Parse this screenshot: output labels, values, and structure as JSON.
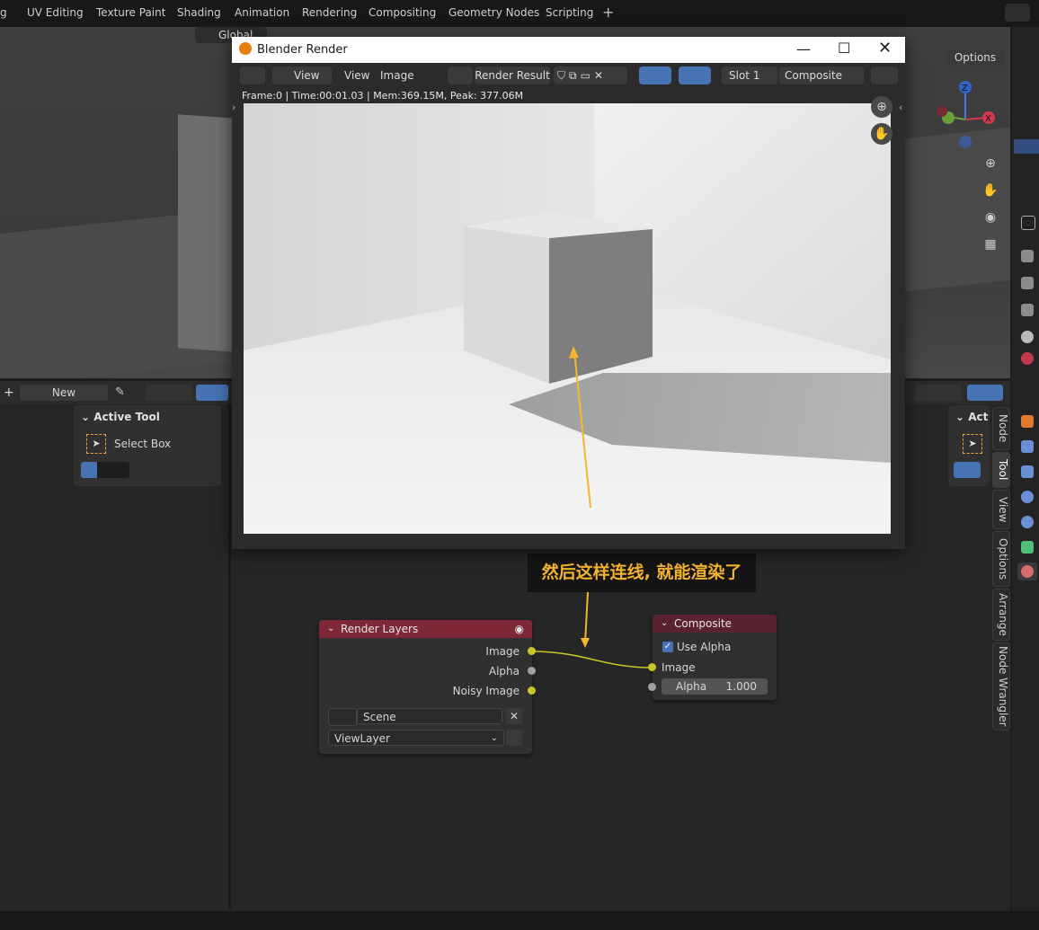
{
  "workspace_tabs": [
    "g",
    "UV Editing",
    "Texture Paint",
    "Shading",
    "Animation",
    "Rendering",
    "Compositing",
    "Geometry Nodes",
    "Scripting",
    "+"
  ],
  "viewport": {
    "transform_orientation": "Global",
    "options_label": "Options"
  },
  "node_editor": {
    "new_button": "New",
    "plus": "+",
    "active_tool_panel": {
      "title": "Active Tool",
      "tool_name": "Select Box"
    },
    "right_tool_title": "Act",
    "side_tabs": [
      "Node",
      "Tool",
      "View",
      "Options",
      "Arrange",
      "Node Wrangler"
    ],
    "render_layers_node": {
      "title": "Render Layers",
      "outputs": [
        "Image",
        "Alpha",
        "Noisy Image"
      ],
      "scene_value": "Scene",
      "viewlayer_value": "ViewLayer"
    },
    "composite_node": {
      "title": "Composite",
      "use_alpha_label": "Use Alpha",
      "use_alpha_checked": true,
      "input_image": "Image",
      "alpha_label": "Alpha",
      "alpha_value": "1.000"
    }
  },
  "render_window": {
    "title": "Blender Render",
    "menu_view_1": "View",
    "menu_view_2": "View",
    "menu_image": "Image",
    "image_name": "Render Result",
    "slot": "Slot 1",
    "pass": "Composite",
    "status": "Frame:0 | Time:00:01.03 | Mem:369.15M, Peak: 377.06M"
  },
  "annotation": {
    "text": "然后这样连线, 就能渲染了",
    "color": "#f5b431"
  },
  "colors": {
    "render_layers_header": "#7d2737",
    "composite_header": "#5a2230",
    "socket_yellow": "#c7c729",
    "socket_gray": "#a1a1a1",
    "accent_blue": "#4772b3",
    "arrow": "#f5b431"
  },
  "icons": [
    "blender-icon",
    "minimize-icon",
    "maximize-icon",
    "close-icon",
    "shield-icon",
    "copy-icon",
    "folder-icon",
    "x-icon",
    "zoom-icon",
    "hand-icon",
    "camera-icon",
    "grid-icon",
    "eye-icon",
    "checkbox-icon",
    "pin-icon"
  ]
}
